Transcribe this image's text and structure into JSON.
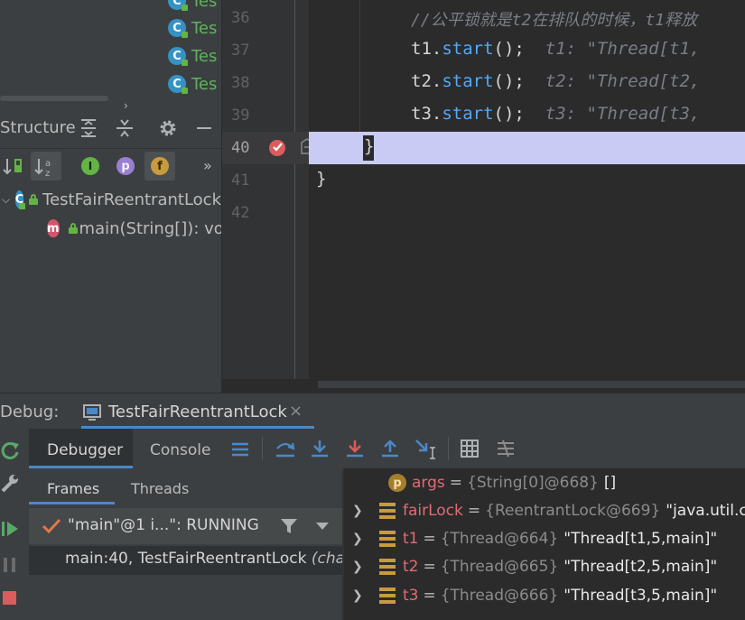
{
  "project_tree": {
    "items": [
      {
        "label": "Tes"
      },
      {
        "label": "Tes"
      },
      {
        "label": "Tes"
      },
      {
        "label": "Tes"
      }
    ]
  },
  "structure": {
    "title": "Structure",
    "class_name": "TestFairReentrantLock",
    "method": "main(String[]): vo"
  },
  "editor": {
    "lines": [
      {
        "num": "36"
      },
      {
        "num": "37"
      },
      {
        "num": "38"
      },
      {
        "num": "39"
      },
      {
        "num": "40"
      },
      {
        "num": "41"
      },
      {
        "num": "42"
      }
    ],
    "comment_36": "//公平锁就是t2在排队的时候，t1释放",
    "code": [
      {
        "var": "t1",
        "call": "start",
        "hint": "t1: \"Thread[t1,"
      },
      {
        "var": "t2",
        "call": "start",
        "hint": "t2: \"Thread[t2,"
      },
      {
        "var": "t3",
        "call": "start",
        "hint": "t3: \"Thread[t3,"
      }
    ],
    "brace_40": "}",
    "brace_41": "}",
    "current_line_color": "#c9cbf5"
  },
  "debug": {
    "label": "Debug:",
    "session_tab": "TestFairReentrantLock",
    "tabs": {
      "debugger": "Debugger",
      "console": "Console"
    },
    "subtabs": {
      "frames": "Frames",
      "threads": "Threads"
    },
    "thread_status": "\"main\"@1 i...\": RUNNING",
    "frame": "main:40, TestFairReentrantLock",
    "frame_suffix": "(cha",
    "variables": [
      {
        "name": "args",
        "ref": "{String[0]@668}",
        "value": "[]",
        "kind": "param"
      },
      {
        "name": "fairLock",
        "ref": "{ReentrantLock@669}",
        "value": "\"java.util.co",
        "kind": "field"
      },
      {
        "name": "t1",
        "ref": "{Thread@664}",
        "value": "\"Thread[t1,5,main]\"",
        "kind": "field"
      },
      {
        "name": "t2",
        "ref": "{Thread@665}",
        "value": "\"Thread[t2,5,main]\"",
        "kind": "field"
      },
      {
        "name": "t3",
        "ref": "{Thread@666}",
        "value": "\"Thread[t3,5,main]\"",
        "kind": "field"
      }
    ],
    "equals": "="
  },
  "icons": {
    "cls": "C",
    "method": "m",
    "param": "p",
    "field_f": "f"
  }
}
